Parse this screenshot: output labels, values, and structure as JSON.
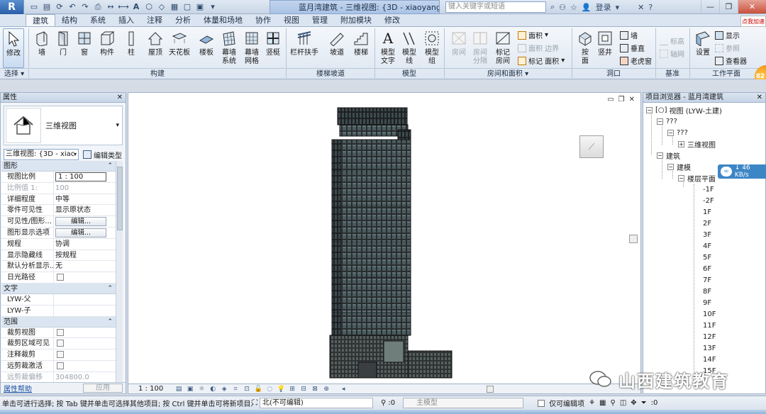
{
  "titlebar": {
    "app_letter": "R",
    "doc_title": "蓝月湾建筑 - 三维视图: {3D - xiaoyang}",
    "help_placeholder": "键入关键字或短语",
    "login": "登录",
    "help": "?"
  },
  "tabs": [
    "建筑",
    "结构",
    "系统",
    "插入",
    "注释",
    "分析",
    "体量和场地",
    "协作",
    "视图",
    "管理",
    "附加模块",
    "修改"
  ],
  "active_tab": "建筑",
  "ribbon": {
    "modify": "修改",
    "select_panel": "选择",
    "build": {
      "wall": "墙",
      "door": "门",
      "window": "窗",
      "component": "构件",
      "column": "柱",
      "roof": "屋顶",
      "ceiling": "天花板",
      "floor": "楼板",
      "curtain_system": [
        "幕墙",
        "系统"
      ],
      "curtain_grid": [
        "幕墙",
        "网格"
      ],
      "mullion": "竖梃",
      "panel": "构建"
    },
    "circulation": {
      "railing": "栏杆扶手",
      "ramp": "坡道",
      "stair": "楼梯",
      "panel": "楼梯坡道"
    },
    "model": {
      "model_text": [
        "模型",
        "文字"
      ],
      "model_line": [
        "模型",
        "线"
      ],
      "model_group": [
        "模型",
        "组"
      ],
      "panel": "模型"
    },
    "room": {
      "room": "房间",
      "room_sep": [
        "房间",
        "分隔"
      ],
      "tag_room": [
        "标记",
        "房间"
      ],
      "area": "面积",
      "area_boundary": "面积 边界",
      "tag_area": "标记 面积",
      "panel": "房间和面积"
    },
    "opening": {
      "by_face": [
        "按",
        "面"
      ],
      "shaft": "竖井",
      "wall": "墙",
      "vertical": "垂直",
      "dormer": "老虎窗",
      "panel": "洞口"
    },
    "datum": {
      "level": "标高",
      "grid": "轴网",
      "panel": "基准"
    },
    "workplane": {
      "set": "设置",
      "show": "显示",
      "ref_plane": "参照",
      "viewer": "查看器",
      "panel": "工作平面"
    },
    "badge": "82",
    "notice": "点我加速"
  },
  "properties": {
    "title": "属性",
    "type_name": "三维视图",
    "type_select": "三维视图: {3D - xiac",
    "edit_type": "编辑类型",
    "sections": [
      {
        "name": "图形",
        "rows": [
          {
            "k": "视图比例",
            "v": "1 : 100",
            "kind": "input"
          },
          {
            "k": "比例值 1:",
            "v": "100",
            "kind": "dim"
          },
          {
            "k": "详细程度",
            "v": "中等",
            "kind": "text"
          },
          {
            "k": "零件可见性",
            "v": "显示原状态",
            "kind": "text"
          },
          {
            "k": "可见性/图形...",
            "v": "编辑...",
            "kind": "button"
          },
          {
            "k": "图形显示选项",
            "v": "编辑...",
            "kind": "button"
          },
          {
            "k": "规程",
            "v": "协调",
            "kind": "text"
          },
          {
            "k": "显示隐藏线",
            "v": "按规程",
            "kind": "text"
          },
          {
            "k": "默认分析显示...",
            "v": "无",
            "kind": "text"
          },
          {
            "k": "日光路径",
            "v": "",
            "kind": "check"
          }
        ]
      },
      {
        "name": "文字",
        "rows": [
          {
            "k": "LYW-父",
            "v": "",
            "kind": "text"
          },
          {
            "k": "LYW-子",
            "v": "",
            "kind": "text"
          }
        ]
      },
      {
        "name": "范围",
        "rows": [
          {
            "k": "裁剪视图",
            "v": "",
            "kind": "check"
          },
          {
            "k": "裁剪区域可见",
            "v": "",
            "kind": "check"
          },
          {
            "k": "注释裁剪",
            "v": "",
            "kind": "check"
          },
          {
            "k": "远剪裁激活",
            "v": "",
            "kind": "check"
          },
          {
            "k": "远剪裁偏移",
            "v": "304800.0",
            "kind": "dim"
          }
        ]
      }
    ],
    "help_link": "属性帮助",
    "apply": "应用"
  },
  "canvas": {
    "view_scale": "1 : 100"
  },
  "browser": {
    "title": "项目浏览器 - 蓝月湾建筑",
    "root": "视图 (LYW-土建)",
    "q1": "???",
    "q2": "???",
    "view3d": "三维视图",
    "arch": "建筑",
    "modeling": "建模",
    "floor_plans": "楼层平面",
    "levels": [
      "-1F",
      "-2F",
      "1F",
      "2F",
      "3F",
      "4F",
      "5F",
      "6F",
      "7F",
      "8F",
      "9F",
      "10F",
      "11F",
      "12F",
      "13F",
      "14F",
      "15F"
    ]
  },
  "speed": "46 KB/s",
  "watermark": "山西建筑教育",
  "status": {
    "message": "单击可进行选择; 按 Tab 键并单击可选择其他项目; 按 Ctrl 键并单击可将新项目添加",
    "workset": "北(不可编辑)",
    "sel_count": ":0",
    "main_model": "主模型",
    "editable_only": "仅可编辑项",
    "filter_count": ":0"
  }
}
